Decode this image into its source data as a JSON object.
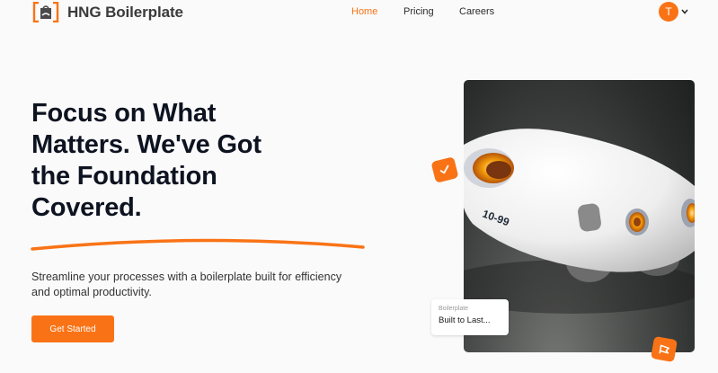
{
  "brand": {
    "name": "HNG Boilerplate",
    "accent_color": "#f97316"
  },
  "nav": {
    "links": [
      {
        "label": "Home",
        "active": true
      },
      {
        "label": "Pricing",
        "active": false
      },
      {
        "label": "Careers",
        "active": false
      }
    ]
  },
  "user": {
    "avatar_initial": "T",
    "menu_icon": "chevron-down-icon"
  },
  "hero": {
    "title_lines": [
      "Focus on What",
      "Matters. We've Got",
      "the Foundation",
      "Covered."
    ],
    "description_lines": [
      "Streamline your processes with a boilerplate built for efficiency",
      "and optimal productivity."
    ],
    "cta_label": "Get Started"
  },
  "showcase": {
    "image_label": "10-99",
    "badge_icon_top": "check-icon",
    "badge_icon_bottom": "flag-icon",
    "card": {
      "label": "Boilerplate",
      "text": "Built to Last..."
    }
  }
}
